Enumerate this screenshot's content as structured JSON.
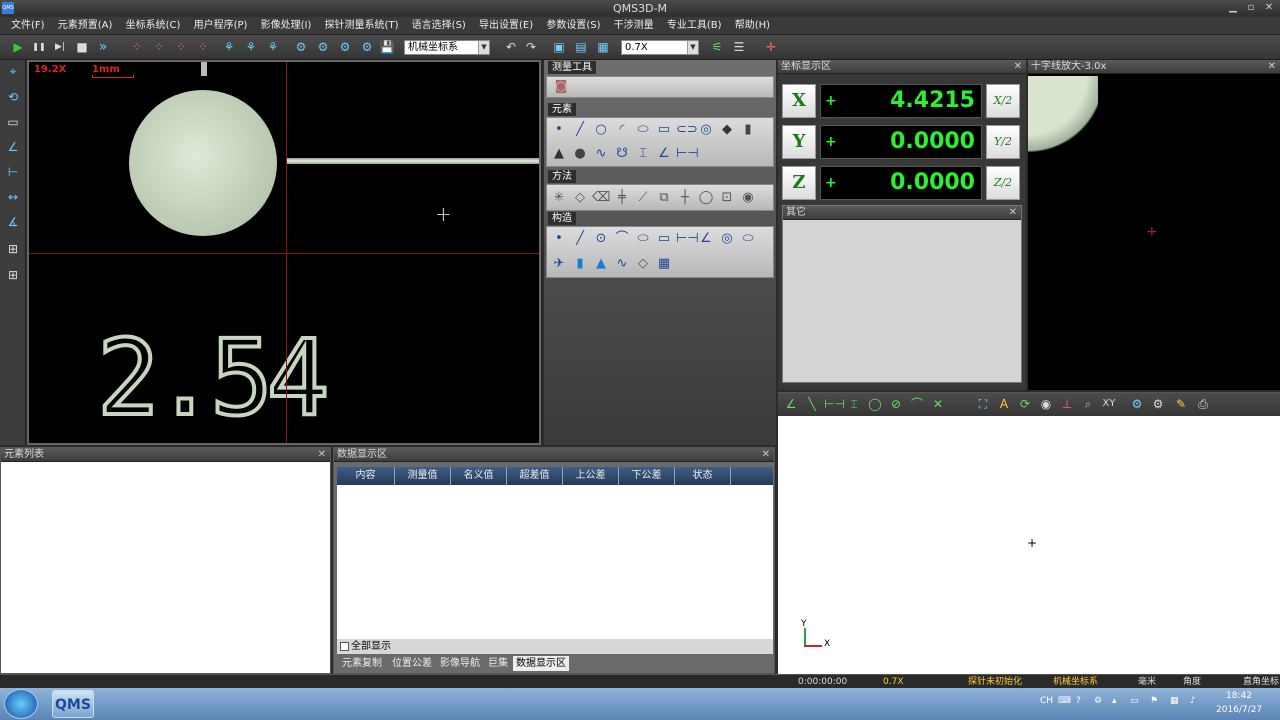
{
  "window": {
    "title": "QMS3D-M",
    "app_icon": "QMS",
    "min": "▁",
    "max": "▫",
    "close": "✕"
  },
  "menu": [
    "文件(F)",
    "元素预置(A)",
    "坐标系统(C)",
    "用户程序(P)",
    "影像处理(I)",
    "探针测量系统(T)",
    "语言选择(S)",
    "导出设置(E)",
    "参数设置(S)",
    "干涉测量",
    "专业工具(B)",
    "帮助(H)"
  ],
  "toolbar": {
    "coord_system": "机械坐标系",
    "zoom": "0.7X",
    "play": "▶",
    "pause": "❚❚",
    "step": "▶|",
    "stop": "■",
    "fast": "»"
  },
  "camera": {
    "zoom_label": "19.2X",
    "scale_label": "1mm",
    "overlay_number": "2.54"
  },
  "tool_panel": {
    "title": "测量工具",
    "groups": [
      {
        "name": "元素"
      },
      {
        "name": "方法"
      },
      {
        "name": "构造"
      }
    ]
  },
  "coord_panel": {
    "title": "坐标显示区",
    "axes": [
      {
        "axis": "X",
        "sign": "+",
        "value": "4.4215",
        "half": "X/2"
      },
      {
        "axis": "Y",
        "sign": "+",
        "value": "0.0000",
        "half": "Y/2"
      },
      {
        "axis": "Z",
        "sign": "+",
        "value": "0.0000",
        "half": "Z/2"
      }
    ],
    "other_title": "其它"
  },
  "cross_panel": {
    "title": "十字线放大-3.0x"
  },
  "element_list": {
    "title": "元素列表"
  },
  "data_panel": {
    "title": "数据显示区",
    "columns": [
      "内容",
      "测量值",
      "名义值",
      "超差值",
      "上公差",
      "下公差",
      "状态"
    ],
    "show_all": "全部显示",
    "tabs": [
      "元素复制",
      "位置公差",
      "影像导航",
      "巨集",
      "数据显示区"
    ]
  },
  "view": {
    "axis_y": "Y",
    "axis_x": "X"
  },
  "status": {
    "time": "0:00:00:00",
    "zoom": "0.7X",
    "probe": "探针未初始化",
    "coord": "机械坐标系",
    "unit": "毫米",
    "angle": "角度",
    "coord_type": "直角坐标"
  },
  "taskbar": {
    "lang": "CH",
    "clock": "18:42",
    "date": "2016/7/27"
  },
  "close_glyph": "✕"
}
